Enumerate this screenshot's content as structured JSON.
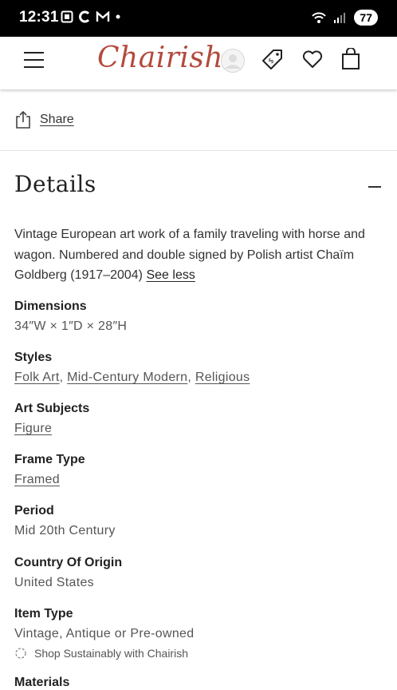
{
  "status_bar": {
    "time": "12:31",
    "battery": "77",
    "icons": [
      "screenshot-icon",
      "c-app-icon",
      "gmail-icon",
      "dot-icon",
      "wifi-icon",
      "signal-icon"
    ]
  },
  "header": {
    "logo": "Chairish",
    "accent_color": "#b34a3e"
  },
  "share": {
    "label": "Share"
  },
  "details": {
    "title": "Details",
    "description": "Vintage European art work of a family traveling with horse and wagon. Numbered and double signed by Polish artist Chaïm Goldberg (1917–2004)",
    "see_less": "See less",
    "dimensions": {
      "label": "Dimensions",
      "value": "34″W × 1″D × 28″H"
    },
    "styles": {
      "label": "Styles",
      "items": [
        "Folk Art",
        "Mid-Century Modern",
        "Religious"
      ],
      "separator": ", "
    },
    "art_subjects": {
      "label": "Art Subjects",
      "value": "Figure"
    },
    "frame_type": {
      "label": "Frame Type",
      "value": "Framed"
    },
    "period": {
      "label": "Period",
      "value": "Mid 20th Century"
    },
    "country": {
      "label": "Country Of Origin",
      "value": "United States"
    },
    "item_type": {
      "label": "Item Type",
      "value": "Vintage, Antique or Pre-owned"
    },
    "sustainably": "Shop Sustainably with Chairish",
    "materials_partial": "Materials"
  }
}
